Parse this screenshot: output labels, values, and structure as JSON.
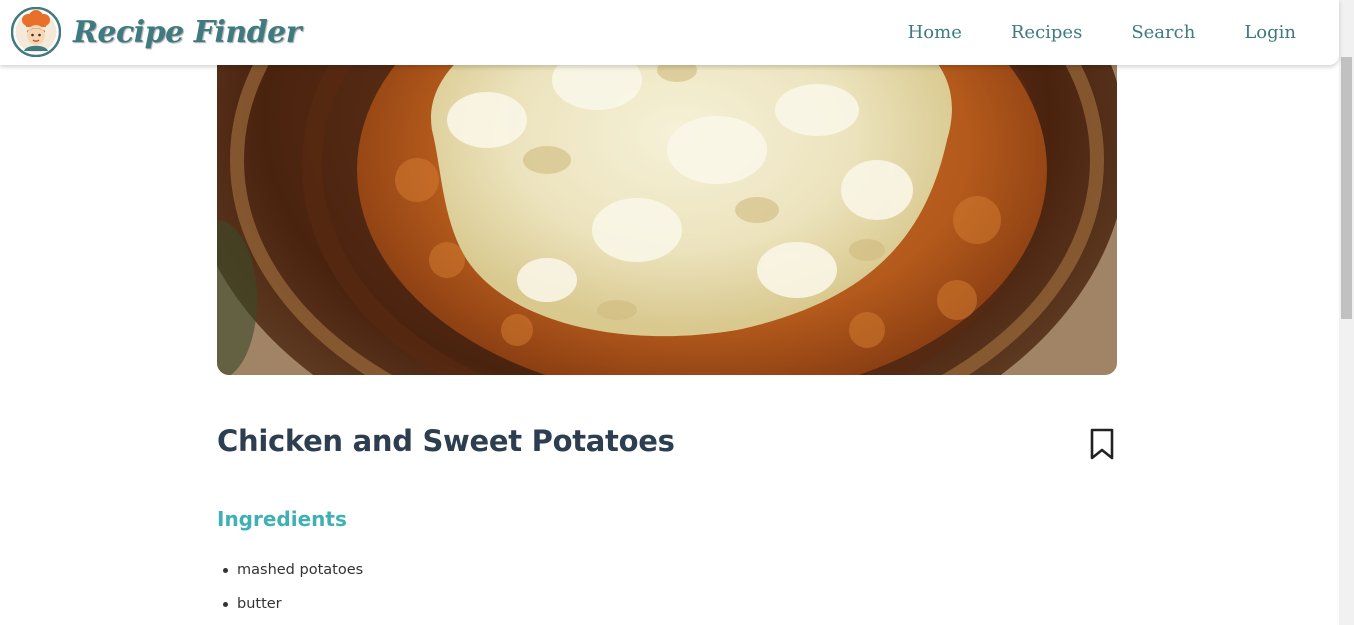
{
  "header": {
    "brand_name": "Recipe Finder",
    "nav": [
      {
        "label": "Home"
      },
      {
        "label": "Recipes"
      },
      {
        "label": "Search"
      },
      {
        "label": "Login"
      }
    ]
  },
  "recipe": {
    "image_alt": "Chicken and Sweet Potatoes dish",
    "title": "Chicken and Sweet Potatoes",
    "bookmark_icon": "bookmark-icon",
    "ingredients_heading": "Ingredients",
    "ingredients": [
      "mashed potatoes",
      "butter"
    ]
  },
  "colors": {
    "brand": "#3e7a80",
    "title": "#2c3e50",
    "accent": "#3fb1b5"
  }
}
